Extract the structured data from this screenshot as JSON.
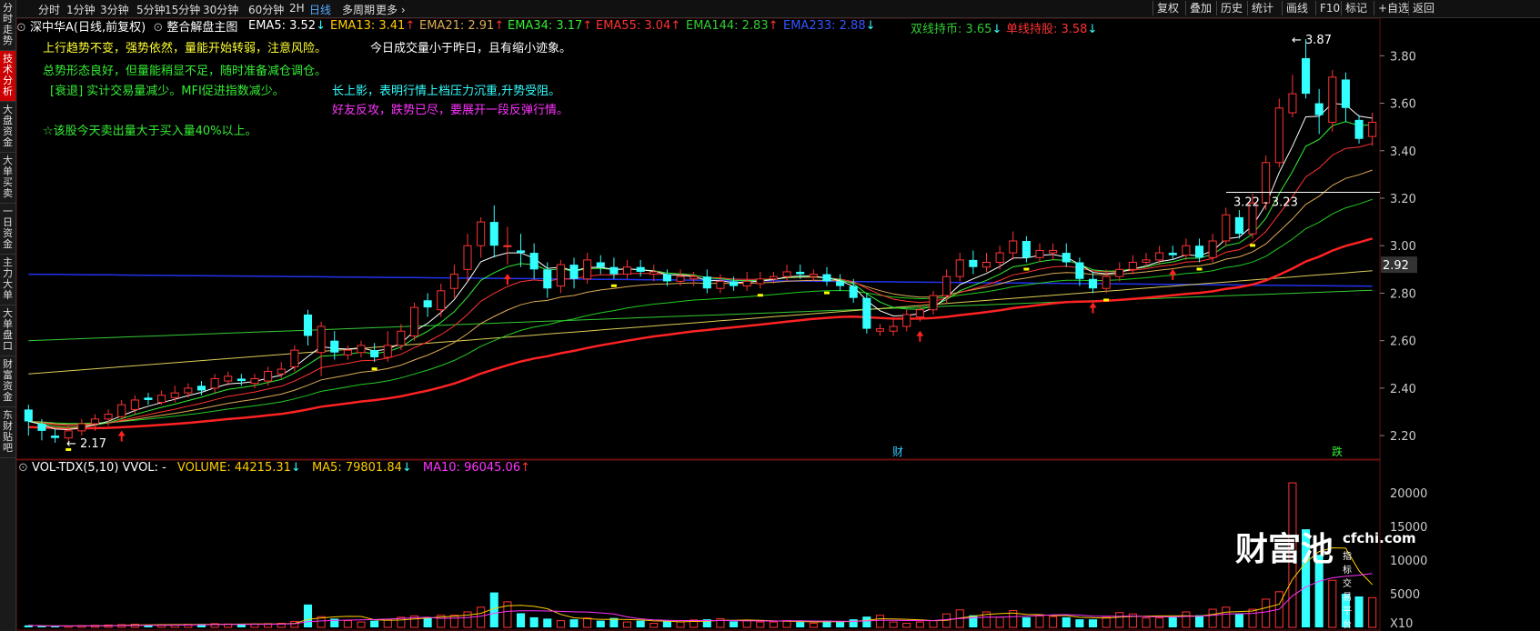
{
  "sidebar": {
    "items": [
      {
        "label": "分时走势",
        "active": false
      },
      {
        "label": "技术分析",
        "active": true
      },
      {
        "label": "大盘资金",
        "active": false
      },
      {
        "label": "大单买卖",
        "active": false
      },
      {
        "label": "一日资金",
        "active": false
      },
      {
        "label": "主力大单",
        "active": false
      },
      {
        "label": "大单盘口",
        "active": false
      },
      {
        "label": "财富资金",
        "active": false
      },
      {
        "label": "东财贴吧",
        "active": false
      }
    ]
  },
  "toolbar": {
    "periods": [
      "分时",
      "1分钟",
      "3分钟",
      "5分钟",
      "15分钟",
      "30分钟",
      "60分钟",
      "2H",
      "日线",
      "多周期",
      "更多"
    ],
    "active_period": "日线",
    "right_buttons": [
      "复权",
      "叠加",
      "历史",
      "统计",
      "画线",
      "F10",
      "标记",
      "+自选",
      "返回"
    ]
  },
  "header": {
    "stock": "深中华A(日线,前复权)",
    "indicator": "整合解盘主图",
    "emas": [
      {
        "label": "EMA5: 3.52",
        "arrow": "↓",
        "color": "#ffffff"
      },
      {
        "label": "EMA13: 3.41",
        "arrow": "↑",
        "color": "#ffcc00"
      },
      {
        "label": "EMA21: 2.91",
        "arrow": "↑",
        "color": "#ddaa55"
      },
      {
        "label": "EMA34: 3.17",
        "arrow": "↑",
        "color": "#33ee33"
      },
      {
        "label": "EMA55: 3.04",
        "arrow": "↑",
        "color": "#ff3333"
      },
      {
        "label": "EMA144: 2.83",
        "arrow": "↑",
        "color": "#33cc33"
      },
      {
        "label": "EMA233: 2.88",
        "arrow": "↓",
        "color": "#3355ff"
      },
      {
        "label": "双线持币: 3.65",
        "arrow": "↓",
        "color": "#33cc33"
      },
      {
        "label": "单线持股: 3.58",
        "arrow": "↓",
        "color": "#ff3333"
      }
    ]
  },
  "signals": [
    {
      "text": "上行趋势不变，强势依然，量能开始转弱，注意风险。",
      "color": "#ffff33"
    },
    {
      "text": "今日成交量小于昨日，且有缩小迹象。",
      "color": "#ffffff"
    },
    {
      "text": "总势形态良好，但量能稍显不足，随时准备减仓调仓。",
      "color": "#33ee33"
    },
    {
      "text": "[衰退] 实计交易量减少。MFI促进指数减少。",
      "color": "#33ee33"
    },
    {
      "text": "长上影，表明行情上档压力沉重,升势受阻。",
      "color": "#33ffff"
    },
    {
      "text": "好友反攻，跌势已尽，要展开一段反弹行情。",
      "color": "#ff33ff"
    },
    {
      "text": "☆该股今天卖出量大于买入量40%以上。",
      "color": "#33ee33"
    }
  ],
  "price_axis": {
    "ticks": [
      "3.80",
      "3.60",
      "3.40",
      "3.20",
      "3.00",
      "2.80",
      "2.60",
      "2.40",
      "2.20"
    ],
    "current": "2.92"
  },
  "annotations": {
    "high": "3.87",
    "low": "2.17",
    "zone": "3.22 - 3.23",
    "marker1": "财",
    "marker2": "跌"
  },
  "volume": {
    "title": "VOL-TDX(5,10) VVOL: -",
    "volume_label": "VOLUME: 44215.31",
    "ma5_label": "MA5: 79801.84",
    "ma10_label": "MA10: 96045.06",
    "ticks": [
      "20000",
      "15000",
      "10000",
      "5000"
    ],
    "unit": "X10"
  },
  "watermark": {
    "brand": "财富池",
    "site": "cfchi.com",
    "slogan": "指标交易平台"
  },
  "chart_data": {
    "type": "candlestick",
    "candles": [
      [
        2.31,
        2.26,
        2.33,
        2.2,
        1
      ],
      [
        2.25,
        2.22,
        2.27,
        2.18,
        1
      ],
      [
        2.2,
        2.19,
        2.23,
        2.17,
        1
      ],
      [
        2.19,
        2.22,
        2.24,
        2.17,
        0
      ],
      [
        2.22,
        2.25,
        2.27,
        2.2,
        0
      ],
      [
        2.25,
        2.27,
        2.29,
        2.22,
        0
      ],
      [
        2.27,
        2.29,
        2.31,
        2.24,
        0
      ],
      [
        2.28,
        2.33,
        2.35,
        2.26,
        0
      ],
      [
        2.31,
        2.35,
        2.37,
        2.29,
        0
      ],
      [
        2.35,
        2.36,
        2.38,
        2.33,
        1
      ],
      [
        2.34,
        2.37,
        2.39,
        2.33,
        0
      ],
      [
        2.36,
        2.38,
        2.41,
        2.34,
        0
      ],
      [
        2.38,
        2.4,
        2.42,
        2.36,
        0
      ],
      [
        2.39,
        2.41,
        2.43,
        2.37,
        1
      ],
      [
        2.4,
        2.44,
        2.46,
        2.38,
        0
      ],
      [
        2.43,
        2.45,
        2.47,
        2.41,
        0
      ],
      [
        2.44,
        2.43,
        2.46,
        2.41,
        1
      ],
      [
        2.42,
        2.44,
        2.46,
        2.4,
        0
      ],
      [
        2.43,
        2.47,
        2.49,
        2.41,
        0
      ],
      [
        2.46,
        2.48,
        2.51,
        2.44,
        0
      ],
      [
        2.49,
        2.56,
        2.58,
        2.47,
        0
      ],
      [
        2.71,
        2.62,
        2.73,
        2.58,
        1
      ],
      [
        2.55,
        2.66,
        2.68,
        2.45,
        0
      ],
      [
        2.6,
        2.55,
        2.64,
        2.52,
        1
      ],
      [
        2.54,
        2.56,
        2.58,
        2.52,
        0
      ],
      [
        2.55,
        2.58,
        2.6,
        2.53,
        0
      ],
      [
        2.56,
        2.53,
        2.59,
        2.51,
        1
      ],
      [
        2.53,
        2.58,
        2.64,
        2.51,
        0
      ],
      [
        2.58,
        2.64,
        2.67,
        2.56,
        0
      ],
      [
        2.62,
        2.74,
        2.76,
        2.6,
        0
      ],
      [
        2.77,
        2.74,
        2.8,
        2.7,
        1
      ],
      [
        2.73,
        2.81,
        2.84,
        2.7,
        0
      ],
      [
        2.82,
        2.88,
        2.92,
        2.78,
        0
      ],
      [
        2.9,
        3.0,
        3.05,
        2.85,
        0
      ],
      [
        3.0,
        3.1,
        3.12,
        2.95,
        0
      ],
      [
        3.1,
        3.0,
        3.17,
        2.95,
        1
      ],
      [
        3.0,
        3.0,
        3.08,
        2.92,
        0
      ],
      [
        2.98,
        2.97,
        3.05,
        2.91,
        1
      ],
      [
        2.97,
        2.9,
        3.01,
        2.86,
        1
      ],
      [
        2.9,
        2.82,
        2.93,
        2.78,
        1
      ],
      [
        2.83,
        2.92,
        2.94,
        2.8,
        0
      ],
      [
        2.92,
        2.86,
        2.95,
        2.82,
        1
      ],
      [
        2.86,
        2.94,
        2.97,
        2.84,
        0
      ],
      [
        2.93,
        2.91,
        2.96,
        2.88,
        1
      ],
      [
        2.91,
        2.88,
        2.95,
        2.86,
        1
      ],
      [
        2.88,
        2.91,
        2.94,
        2.86,
        0
      ],
      [
        2.91,
        2.89,
        2.94,
        2.87,
        1
      ],
      [
        2.89,
        2.88,
        2.92,
        2.85,
        0
      ],
      [
        2.88,
        2.85,
        2.9,
        2.83,
        1
      ],
      [
        2.85,
        2.87,
        2.9,
        2.83,
        0
      ],
      [
        2.87,
        2.86,
        2.89,
        2.83,
        0
      ],
      [
        2.87,
        2.82,
        2.9,
        2.8,
        1
      ],
      [
        2.82,
        2.85,
        2.88,
        2.8,
        0
      ],
      [
        2.85,
        2.83,
        2.87,
        2.81,
        1
      ],
      [
        2.83,
        2.85,
        2.89,
        2.81,
        0
      ],
      [
        2.84,
        2.86,
        2.89,
        2.82,
        0
      ],
      [
        2.86,
        2.87,
        2.89,
        2.84,
        0
      ],
      [
        2.87,
        2.89,
        2.92,
        2.85,
        0
      ],
      [
        2.89,
        2.88,
        2.92,
        2.86,
        1
      ],
      [
        2.88,
        2.87,
        2.9,
        2.85,
        0
      ],
      [
        2.88,
        2.85,
        2.91,
        2.83,
        1
      ],
      [
        2.85,
        2.83,
        2.88,
        2.81,
        1
      ],
      [
        2.83,
        2.78,
        2.86,
        2.76,
        1
      ],
      [
        2.78,
        2.65,
        2.8,
        2.63,
        1
      ],
      [
        2.65,
        2.64,
        2.67,
        2.62,
        0
      ],
      [
        2.64,
        2.66,
        2.69,
        2.62,
        0
      ],
      [
        2.66,
        2.71,
        2.73,
        2.64,
        0
      ],
      [
        2.7,
        2.73,
        2.75,
        2.68,
        0
      ],
      [
        2.73,
        2.79,
        2.81,
        2.71,
        0
      ],
      [
        2.79,
        2.87,
        2.9,
        2.76,
        0
      ],
      [
        2.87,
        2.94,
        2.97,
        2.85,
        0
      ],
      [
        2.94,
        2.91,
        2.98,
        2.88,
        1
      ],
      [
        2.91,
        2.93,
        2.97,
        2.89,
        0
      ],
      [
        2.93,
        2.97,
        3.0,
        2.9,
        0
      ],
      [
        2.97,
        3.02,
        3.06,
        2.94,
        0
      ],
      [
        3.02,
        2.95,
        3.04,
        2.93,
        1
      ],
      [
        2.95,
        2.98,
        3.01,
        2.93,
        0
      ],
      [
        2.98,
        2.97,
        3.01,
        2.94,
        0
      ],
      [
        2.97,
        2.93,
        3.01,
        2.91,
        1
      ],
      [
        2.93,
        2.86,
        2.95,
        2.83,
        1
      ],
      [
        2.86,
        2.82,
        2.89,
        2.8,
        1
      ],
      [
        2.82,
        2.87,
        2.9,
        2.8,
        0
      ],
      [
        2.87,
        2.9,
        2.93,
        2.85,
        0
      ],
      [
        2.9,
        2.93,
        2.96,
        2.88,
        0
      ],
      [
        2.93,
        2.94,
        2.97,
        2.91,
        0
      ],
      [
        2.94,
        2.97,
        3.0,
        2.92,
        0
      ],
      [
        2.97,
        2.96,
        3.0,
        2.94,
        1
      ],
      [
        2.96,
        3.0,
        3.03,
        2.94,
        0
      ],
      [
        3.0,
        2.95,
        3.03,
        2.93,
        1
      ],
      [
        2.95,
        3.02,
        3.05,
        2.93,
        0
      ],
      [
        3.02,
        3.13,
        3.16,
        3.0,
        0
      ],
      [
        3.12,
        3.05,
        3.15,
        3.03,
        1
      ],
      [
        3.05,
        3.18,
        3.22,
        3.03,
        0
      ],
      [
        3.18,
        3.35,
        3.38,
        3.15,
        0
      ],
      [
        3.35,
        3.58,
        3.62,
        3.33,
        0
      ],
      [
        3.56,
        3.64,
        3.72,
        3.54,
        0
      ],
      [
        3.64,
        3.79,
        3.87,
        3.62,
        1
      ],
      [
        3.6,
        3.55,
        3.66,
        3.47,
        1
      ],
      [
        3.52,
        3.71,
        3.74,
        3.48,
        0
      ],
      [
        3.7,
        3.58,
        3.73,
        3.52,
        1
      ],
      [
        3.53,
        3.45,
        3.55,
        3.43,
        1
      ],
      [
        3.46,
        3.52,
        3.56,
        3.42,
        0
      ]
    ],
    "volume": [
      30,
      20,
      15,
      20,
      25,
      30,
      35,
      40,
      45,
      35,
      40,
      40,
      45,
      50,
      55,
      50,
      45,
      50,
      55,
      60,
      90,
      340,
      160,
      130,
      100,
      80,
      100,
      120,
      150,
      170,
      150,
      180,
      180,
      230,
      300,
      520,
      380,
      210,
      150,
      130,
      100,
      120,
      140,
      100,
      140,
      80,
      100,
      60,
      90,
      80,
      110,
      120,
      130,
      90,
      100,
      80,
      80,
      100,
      80,
      60,
      100,
      80,
      120,
      160,
      180,
      80,
      60,
      80,
      100,
      200,
      260,
      180,
      230,
      150,
      250,
      150,
      170,
      160,
      150,
      120,
      120,
      150,
      220,
      200,
      140,
      140,
      150,
      230,
      180,
      270,
      300,
      200,
      270,
      420,
      530,
      2150,
      1460,
      1080,
      700,
      500,
      460,
      442
    ],
    "ylim": [
      2.12,
      3.92
    ]
  }
}
